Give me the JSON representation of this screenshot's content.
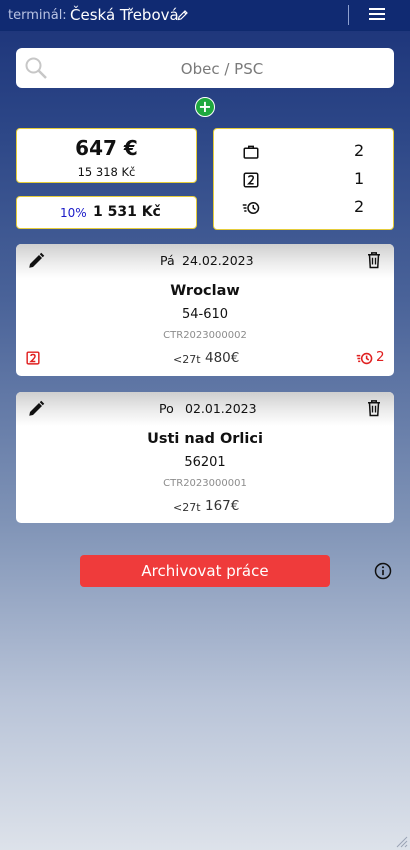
{
  "header": {
    "terminal_label": "terminál:",
    "terminal_name": "Česká Třebová"
  },
  "search": {
    "placeholder": "Obec / PSC"
  },
  "summary": {
    "price_eur": "647 €",
    "price_czk": "15 318 Kč",
    "percent": "10%",
    "percent_value": "1 531 Kč",
    "stats": [
      {
        "icon": "briefcase-icon",
        "value": "2"
      },
      {
        "icon": "number-2-box-icon",
        "value": "1"
      },
      {
        "icon": "clock-fast-icon",
        "value": "2"
      }
    ]
  },
  "jobs": [
    {
      "day": "Pá",
      "date": "24.02.2023",
      "city": "Wroclaw",
      "zip": "54-610",
      "code": "CTR2023000002",
      "weight": "<27t",
      "price": "480€",
      "has_badge": true,
      "time_count": "2"
    },
    {
      "day": "Po",
      "date": "02.01.2023",
      "city": "Usti nad Orlici",
      "zip": "56201",
      "code": "CTR2023000001",
      "weight": "<27t",
      "price": "167€",
      "has_badge": false,
      "time_count": ""
    }
  ],
  "footer": {
    "archive_label": "Archivovat práce"
  },
  "colors": {
    "header_bg": "#102a72",
    "card_border": "#e5cc3a",
    "archive_button": "#ef3b3b",
    "add_button": "#1fa83e",
    "alert_red": "#e02020",
    "percent_blue": "#1a1ac8"
  }
}
